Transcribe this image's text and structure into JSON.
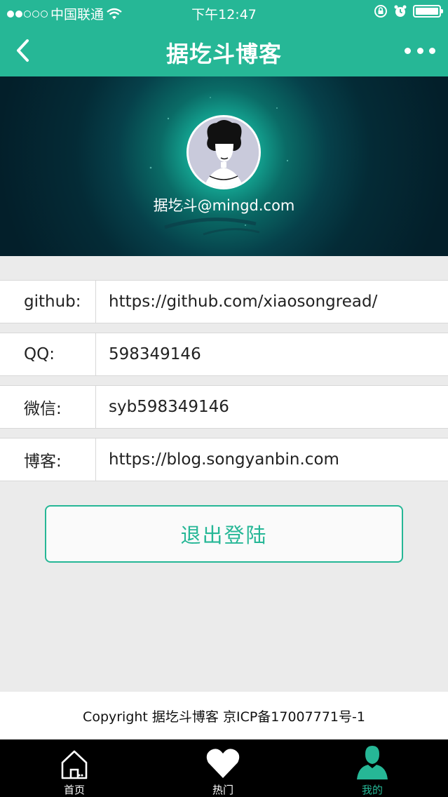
{
  "status_bar": {
    "carrier": "中国联通",
    "time": "下午12:47",
    "signal_bars": 2,
    "battery_level": 1.0
  },
  "nav": {
    "title": "据圪斗博客",
    "back_icon": "chevron-left-icon",
    "more_icon": "more-dots-icon"
  },
  "profile": {
    "email": "据圪斗@mingd.com"
  },
  "info": [
    {
      "label": "github:",
      "value": "https://github.com/xiaosongread/"
    },
    {
      "label": "QQ:",
      "value": "598349146"
    },
    {
      "label": "微信:",
      "value": "syb598349146"
    },
    {
      "label": "博客:",
      "value": "https://blog.songyanbin.com"
    }
  ],
  "logout_label": "退出登陆",
  "footer": "Copyright 据圪斗博客 京ICP备17007771号-1",
  "tabs": [
    {
      "label": "首页",
      "icon": "home-icon"
    },
    {
      "label": "热门",
      "icon": "heart-icon"
    },
    {
      "label": "我的",
      "icon": "user-icon"
    }
  ],
  "colors": {
    "accent": "#26b796"
  }
}
